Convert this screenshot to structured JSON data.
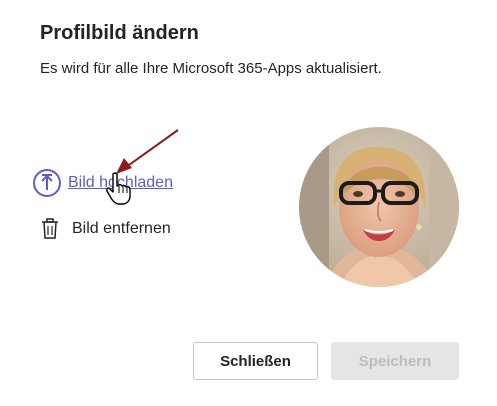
{
  "dialog": {
    "title": "Profilbild ändern",
    "subtitle": "Es wird für alle Ihre Microsoft 365-Apps aktualisiert."
  },
  "actions": {
    "upload_label": "Bild hochladen",
    "remove_label": "Bild entfernen"
  },
  "buttons": {
    "close_label": "Schließen",
    "save_label": "Speichern"
  },
  "colors": {
    "accent": "#5b5fc7",
    "annotation_arrow": "#8b1a1a",
    "disabled_bg": "#e5e5e5",
    "disabled_text": "#bdbdbd"
  },
  "icons": {
    "upload": "upload-arrow-circle-icon",
    "remove": "trash-icon",
    "cursor": "hand-pointer-icon"
  }
}
